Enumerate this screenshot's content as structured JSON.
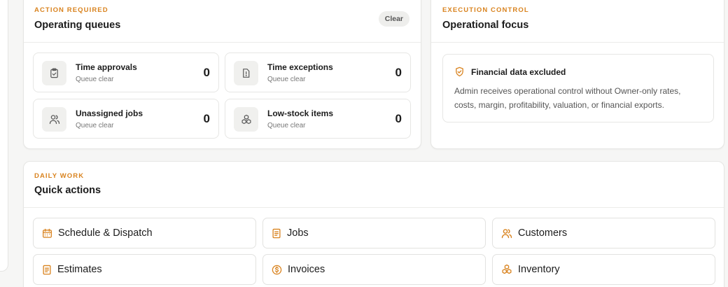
{
  "colors": {
    "accent": "#d9831f",
    "icon_gray": "#5a5a5a"
  },
  "queues": {
    "eyebrow": "ACTION REQUIRED",
    "title": "Operating queues",
    "clear_label": "Clear",
    "tiles": [
      {
        "label": "Time approvals",
        "status": "Queue clear",
        "count": "0",
        "icon": "clipboard-check-icon"
      },
      {
        "label": "Time exceptions",
        "status": "Queue clear",
        "count": "0",
        "icon": "alert-file-icon"
      },
      {
        "label": "Unassigned jobs",
        "status": "Queue clear",
        "count": "0",
        "icon": "users-icon"
      },
      {
        "label": "Low-stock items",
        "status": "Queue clear",
        "count": "0",
        "icon": "boxes-icon"
      }
    ]
  },
  "focus": {
    "eyebrow": "EXECUTION CONTROL",
    "title": "Operational focus",
    "notice_title": "Financial data excluded",
    "notice_body": "Admin receives operational control without Owner-only rates, costs, margin, profitability, valuation, or financial exports.",
    "notice_icon": "shield-check-icon"
  },
  "quick": {
    "eyebrow": "DAILY WORK",
    "title": "Quick actions",
    "actions": [
      {
        "label": "Schedule & Dispatch",
        "icon": "calendar-icon"
      },
      {
        "label": "Jobs",
        "icon": "document-icon"
      },
      {
        "label": "Customers",
        "icon": "users-icon"
      },
      {
        "label": "Estimates",
        "icon": "document-icon"
      },
      {
        "label": "Invoices",
        "icon": "dollar-circle-icon"
      },
      {
        "label": "Inventory",
        "icon": "boxes-icon"
      }
    ]
  }
}
